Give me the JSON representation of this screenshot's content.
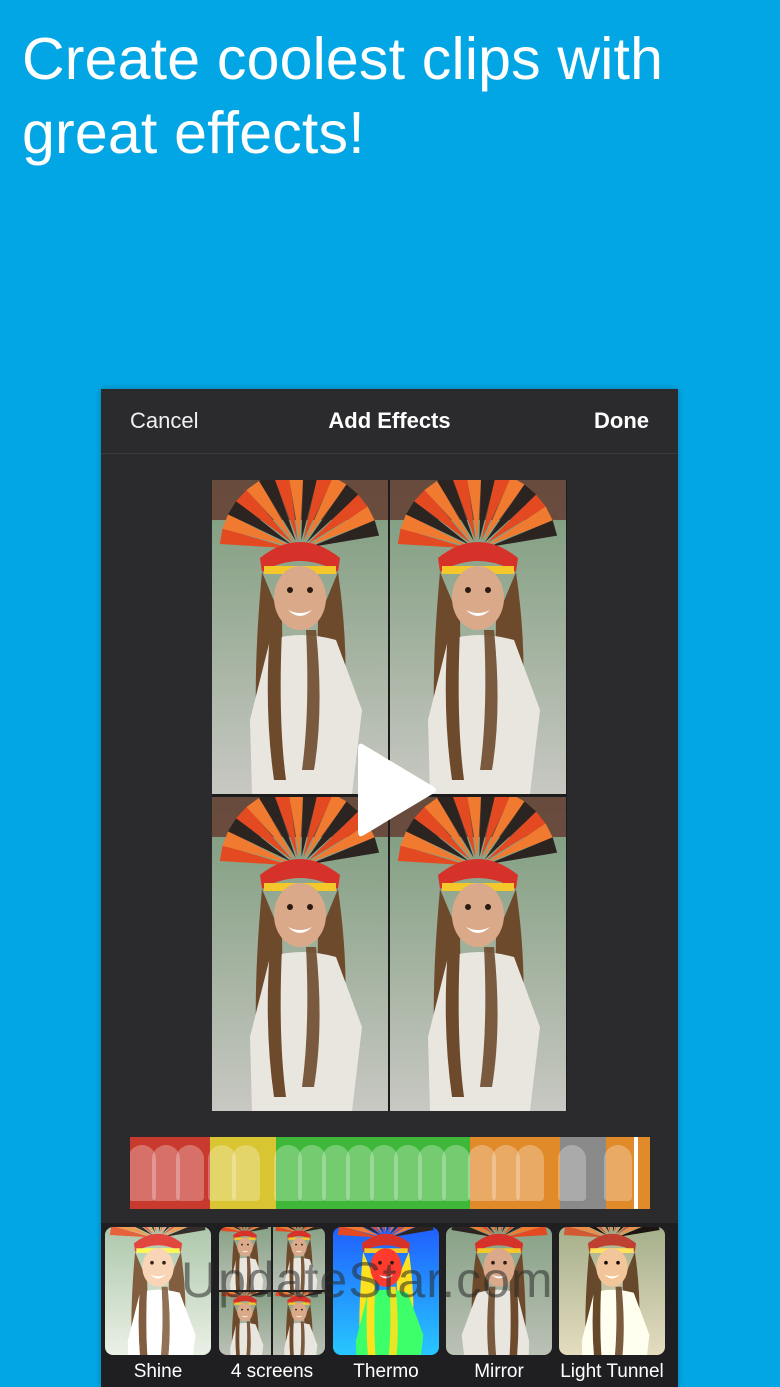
{
  "headline": {
    "line1": "Create coolest clips with",
    "line2": "great effects!"
  },
  "navbar": {
    "cancel_label": "Cancel",
    "title": "Add Effects",
    "done_label": "Done"
  },
  "preview": {
    "play_icon": "play-icon",
    "layout": "4 screens"
  },
  "timeline": {
    "segment_colors": [
      "#c83a2e",
      "#d8c531",
      "#3fb83a",
      "#e08a2a",
      "#8a8a8a",
      "#e08a2a"
    ]
  },
  "effects": [
    {
      "label": "Shine"
    },
    {
      "label": "4 screens"
    },
    {
      "label": "Thermo"
    },
    {
      "label": "Mirror"
    },
    {
      "label": "Light Tunnel"
    }
  ],
  "watermark": "UpdateStar.com",
  "colors": {
    "background": "#03a6e4",
    "panel": "#2b2b2e",
    "effects_bar": "#1f1f22"
  }
}
